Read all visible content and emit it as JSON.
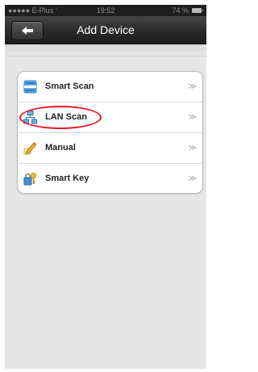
{
  "status_bar": {
    "carrier": "●●●●● E-Plus '",
    "time": "19:52",
    "battery": "74 %",
    "battery_icon": "battery-icon"
  },
  "navbar": {
    "title": "Add Device",
    "back_icon": "back-arrow-icon"
  },
  "menu": {
    "items": [
      {
        "label": "Smart Scan",
        "icon": "smart-scan-icon",
        "chevron": "≫"
      },
      {
        "label": "LAN Scan",
        "icon": "lan-network-icon",
        "chevron": "≫",
        "highlighted": true
      },
      {
        "label": "Manual",
        "icon": "pencil-icon",
        "chevron": "≫"
      },
      {
        "label": "Smart Key",
        "icon": "key-lock-icon",
        "chevron": "≫"
      }
    ]
  },
  "colors": {
    "highlight_ring": "#e01d2a",
    "navbar": "#2a2a2a",
    "background": "#e6e6e6"
  }
}
